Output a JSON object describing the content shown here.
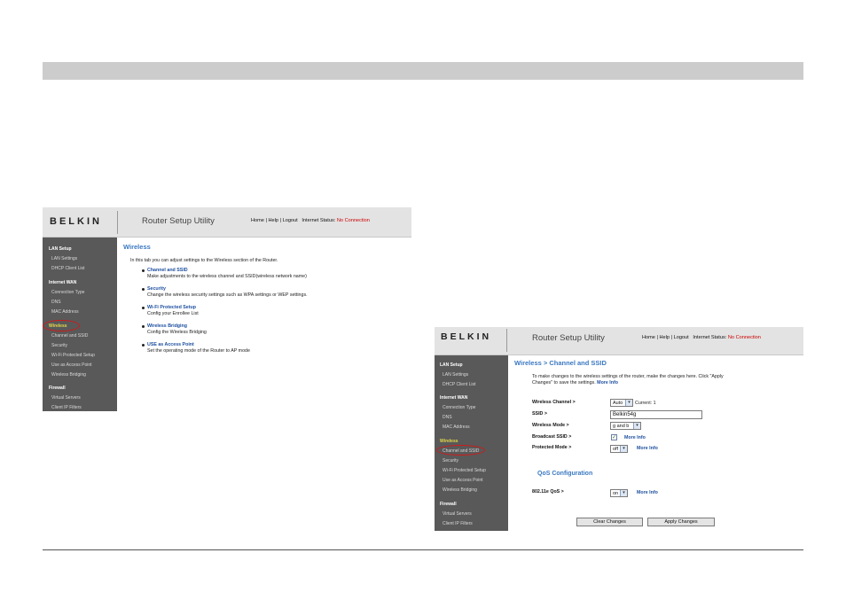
{
  "shot_left": {
    "logo": "BELKIN",
    "util_title": "Router Setup Utility",
    "links": {
      "home": "Home",
      "help": "Help",
      "logout": "Logout",
      "status_label": "Internet Status:",
      "status_value": "No Connection",
      "sep": "|"
    },
    "sidebar": {
      "lan_setup": "LAN Setup",
      "lan_settings": "LAN Settings",
      "dhcp_client_list": "DHCP Client List",
      "internet_wan": "Internet WAN",
      "connection_type": "Connection Type",
      "dns": "DNS",
      "mac_address": "MAC Address",
      "wireless": "Wireless",
      "channel_ssid": "Channel and SSID",
      "security": "Security",
      "wifi_protected_setup": "Wi-Fi Protected Setup",
      "use_as_access_point": "Use as Access Point",
      "wireless_bridging": "Wireless Bridging",
      "firewall": "Firewall",
      "virtual_servers": "Virtual Servers",
      "client_ip_filters": "Client IP Filters"
    },
    "main": {
      "title": "Wireless",
      "intro": "In this tab you can adjust settings to the Wireless section of the Router.",
      "items": [
        {
          "link": "Channel and SSID",
          "desc": "Make adjustments to the wireless channel and SSID(wireless network name)"
        },
        {
          "link": "Security",
          "desc": "Change the wireless security settings such as WPA settings or WEP settings."
        },
        {
          "link": "Wi-Fi Protected Setup",
          "desc": "Config your Enrollee List"
        },
        {
          "link": "Wireless Bridging",
          "desc": "Config the Wireless Bridging"
        },
        {
          "link": "USE as Access Point",
          "desc": "Set the operating mode of the Router to AP mode"
        }
      ]
    }
  },
  "shot_right": {
    "logo": "BELKIN",
    "util_title": "Router Setup Utility",
    "links": {
      "home": "Home",
      "help": "Help",
      "logout": "Logout",
      "status_label": "Internet Status:",
      "status_value": "No Connection",
      "sep": "|"
    },
    "sidebar": {
      "lan_setup": "LAN Setup",
      "lan_settings": "LAN Settings",
      "dhcp_client_list": "DHCP Client List",
      "internet_wan": "Internet WAN",
      "connection_type": "Connection Type",
      "dns": "DNS",
      "mac_address": "MAC Address",
      "wireless": "Wireless",
      "channel_ssid": "Channel and SSID",
      "security": "Security",
      "wifi_protected_setup": "Wi-Fi Protected Setup",
      "use_as_access_point": "Use as Access Point",
      "wireless_bridging": "Wireless Bridging",
      "firewall": "Firewall",
      "virtual_servers": "Virtual Servers",
      "client_ip_filters": "Client IP Filters"
    },
    "main": {
      "title": "Wireless > Channel and SSID",
      "intro_line1": "To make changes to the wireless settings of the router, make the changes here. Click \"Apply",
      "intro_line2": "Changes\" to save the settings.",
      "intro_more": "More Info",
      "wireless_channel_label": "Wireless Channel >",
      "wireless_channel_value": "Auto",
      "current_label": "Current:",
      "current_value": "1",
      "ssid_label": "SSID >",
      "ssid_value": "Belkin54g",
      "wireless_mode_label": "Wireless Mode >",
      "wireless_mode_value": "g and b",
      "broadcast_ssid_label": "Broadcast SSID >",
      "broadcast_ssid_checked": "✓",
      "protected_mode_label": "Protected Mode >",
      "protected_mode_value": "off",
      "more_info": "More Info",
      "qos_title": "QoS Configuration",
      "qos_label": "802.11e QoS >",
      "qos_value": "on",
      "clear_button": "Clear Changes",
      "apply_button": "Apply Changes"
    }
  },
  "icons": {
    "select_arrow": "▾"
  },
  "colors": {
    "band": "#cccccc",
    "sidebar": "#595959",
    "title_blue": "#3a78c2",
    "status_red": "#cc0000",
    "highlight_circle": "#d01a1a"
  }
}
